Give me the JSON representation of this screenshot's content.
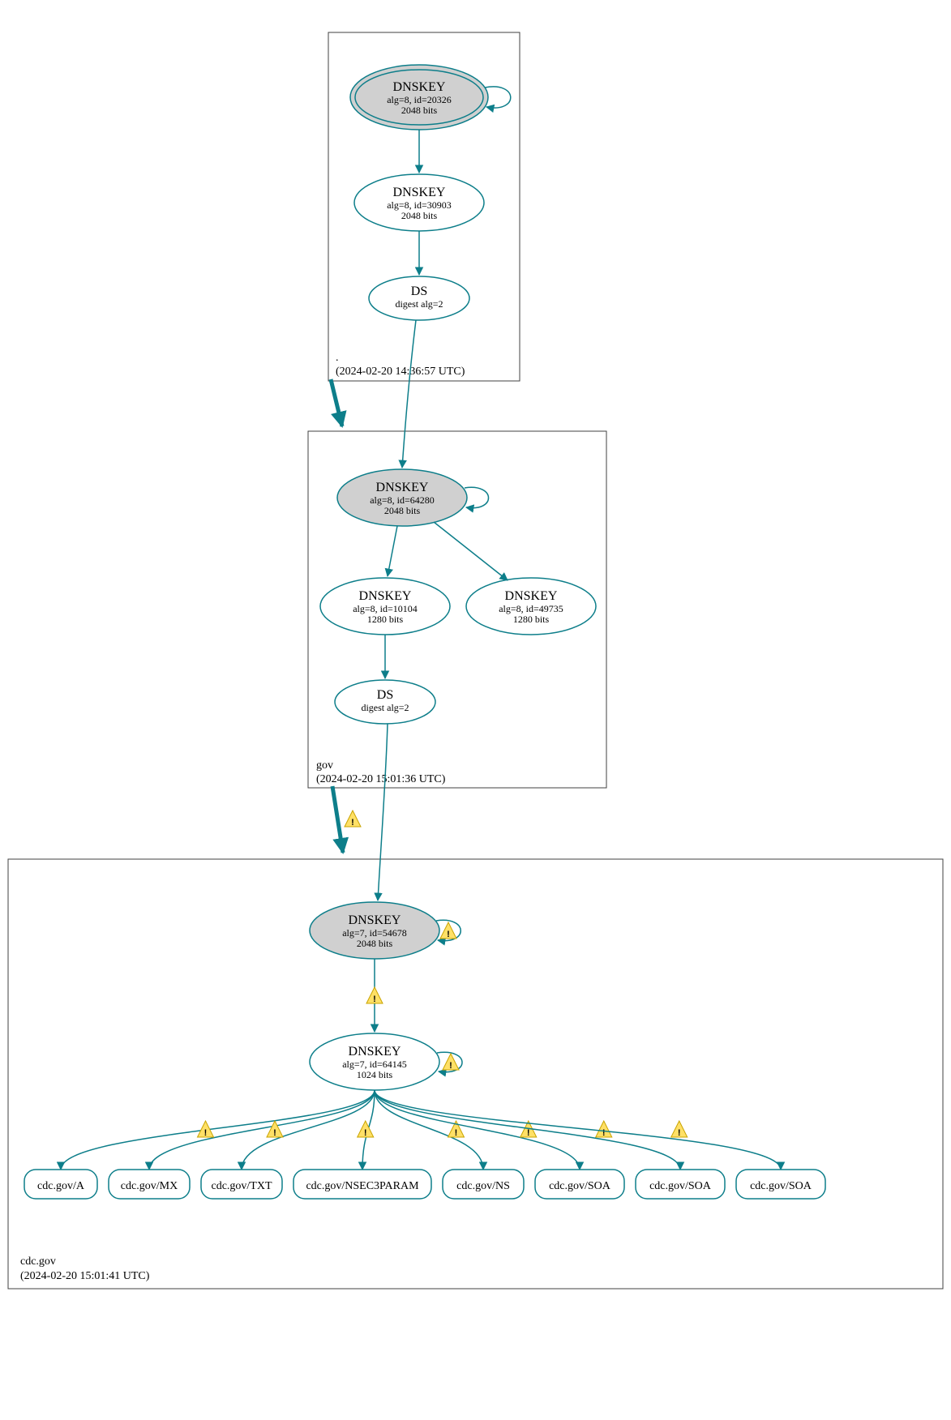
{
  "colors": {
    "teal": "#0d7e8a",
    "grey": "#d0d0d0",
    "white": "#ffffff"
  },
  "zones": {
    "root": {
      "name": ".",
      "ts": "(2024-02-20 14:36:57 UTC)"
    },
    "gov": {
      "name": "gov",
      "ts": "(2024-02-20 15:01:36 UTC)"
    },
    "cdc": {
      "name": "cdc.gov",
      "ts": "(2024-02-20 15:01:41 UTC)"
    }
  },
  "nodes": {
    "root_ksk": {
      "title": "DNSKEY",
      "l1": "alg=8, id=20326",
      "l2": "2048 bits"
    },
    "root_zsk": {
      "title": "DNSKEY",
      "l1": "alg=8, id=30903",
      "l2": "2048 bits"
    },
    "root_ds": {
      "title": "DS",
      "l1": "digest alg=2",
      "l2": ""
    },
    "gov_ksk": {
      "title": "DNSKEY",
      "l1": "alg=8, id=64280",
      "l2": "2048 bits"
    },
    "gov_zsk": {
      "title": "DNSKEY",
      "l1": "alg=8, id=10104",
      "l2": "1280 bits"
    },
    "gov_zsk2": {
      "title": "DNSKEY",
      "l1": "alg=8, id=49735",
      "l2": "1280 bits"
    },
    "gov_ds": {
      "title": "DS",
      "l1": "digest alg=2",
      "l2": ""
    },
    "cdc_ksk": {
      "title": "DNSKEY",
      "l1": "alg=7, id=54678",
      "l2": "2048 bits"
    },
    "cdc_zsk": {
      "title": "DNSKEY",
      "l1": "alg=7, id=64145",
      "l2": "1024 bits"
    }
  },
  "rr": [
    "cdc.gov/A",
    "cdc.gov/MX",
    "cdc.gov/TXT",
    "cdc.gov/NSEC3PARAM",
    "cdc.gov/NS",
    "cdc.gov/SOA",
    "cdc.gov/SOA",
    "cdc.gov/SOA"
  ]
}
